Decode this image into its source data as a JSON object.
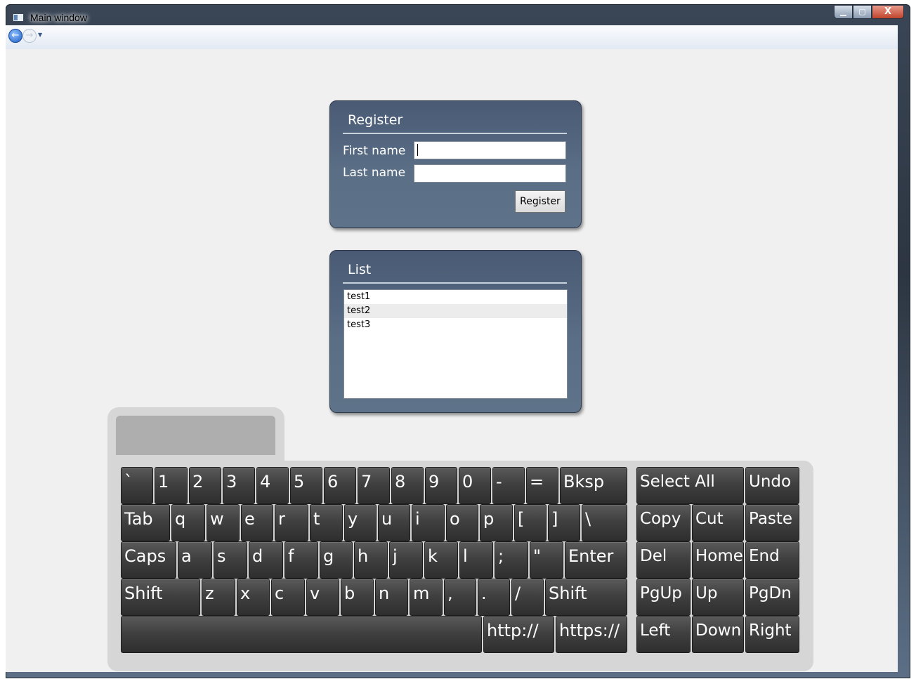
{
  "window": {
    "title": "Main window",
    "controls": {
      "minimize": "▁",
      "maximize": "▢",
      "close": "X"
    }
  },
  "nav": {
    "back_icon": "arrow-left-icon",
    "forward_icon": "arrow-right-icon",
    "dropdown_icon": "chevron-down-icon",
    "back_glyph": "←",
    "forward_glyph": "→",
    "drop_glyph": "▼"
  },
  "register": {
    "title": "Register",
    "first_name_label": "First name",
    "first_name_value": "",
    "last_name_label": "Last name",
    "last_name_value": "",
    "button_label": "Register"
  },
  "list": {
    "title": "List",
    "items": [
      "test1",
      "test2",
      "test3"
    ],
    "highlighted_index": 1
  },
  "keyboard": {
    "rows": [
      [
        "`",
        "1",
        "2",
        "3",
        "4",
        "5",
        "6",
        "7",
        "8",
        "9",
        "0",
        "-",
        "=",
        "Bksp"
      ],
      [
        "Tab",
        "q",
        "w",
        "e",
        "r",
        "t",
        "y",
        "u",
        "i",
        "o",
        "p",
        "[",
        "]",
        "\\"
      ],
      [
        "Caps",
        "a",
        "s",
        "d",
        "f",
        "g",
        "h",
        "j",
        "k",
        "l",
        ";",
        "\"",
        "Enter"
      ],
      [
        "Shift",
        "z",
        "x",
        "c",
        "v",
        "b",
        "n",
        "m",
        ",",
        ".",
        "/",
        "Shift"
      ],
      [
        "",
        "http://",
        "https://"
      ]
    ],
    "edit_keys": [
      [
        "Select All",
        "Undo"
      ],
      [
        "Copy",
        "Cut",
        "Paste"
      ],
      [
        "Del",
        "Home",
        "End"
      ],
      [
        "PgUp",
        "Up",
        "PgDn"
      ],
      [
        "Left",
        "Down",
        "Right"
      ]
    ]
  }
}
